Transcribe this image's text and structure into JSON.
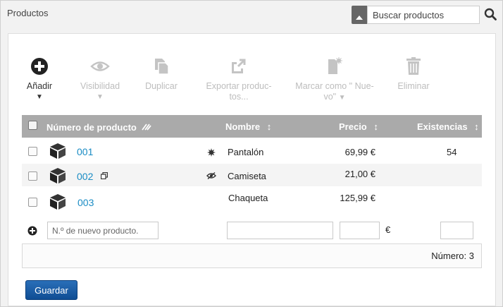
{
  "header": {
    "title": "Productos",
    "search_placeholder": "Buscar productos"
  },
  "toolbar": {
    "add": "Añadir",
    "visibility": "Visibilidad",
    "duplicate": "Duplicar",
    "export_line1": "Exportar produc-",
    "export_line2": "tos...",
    "mark_new_line1": "Marcar como \" Nue-",
    "mark_new_line2": "vo\"",
    "delete": "Eliminar"
  },
  "table": {
    "headers": {
      "number": "Número de producto",
      "name": "Nombre",
      "price": "Precio",
      "stock": "Existencias"
    },
    "rows": [
      {
        "number": "001",
        "name": "Pantalón",
        "price": "69,99 €",
        "stock": "54",
        "status_icon": "starburst-icon"
      },
      {
        "number": "002",
        "name": "Camiseta",
        "price": "21,00 €",
        "stock": "",
        "status_icon": "eye-hidden-icon"
      },
      {
        "number": "003",
        "name": "Chaqueta",
        "price": "125,99 €",
        "stock": "",
        "status_icon": ""
      }
    ],
    "new_row": {
      "number_placeholder": "N.º de nuevo producto.",
      "currency": "€"
    },
    "footer_count": "Número: 3"
  },
  "actions": {
    "save": "Guardar"
  },
  "colors": {
    "accent": "#1a8cc4",
    "header_bg": "#aaaaaa",
    "save_btn": "#1a5ea8"
  }
}
